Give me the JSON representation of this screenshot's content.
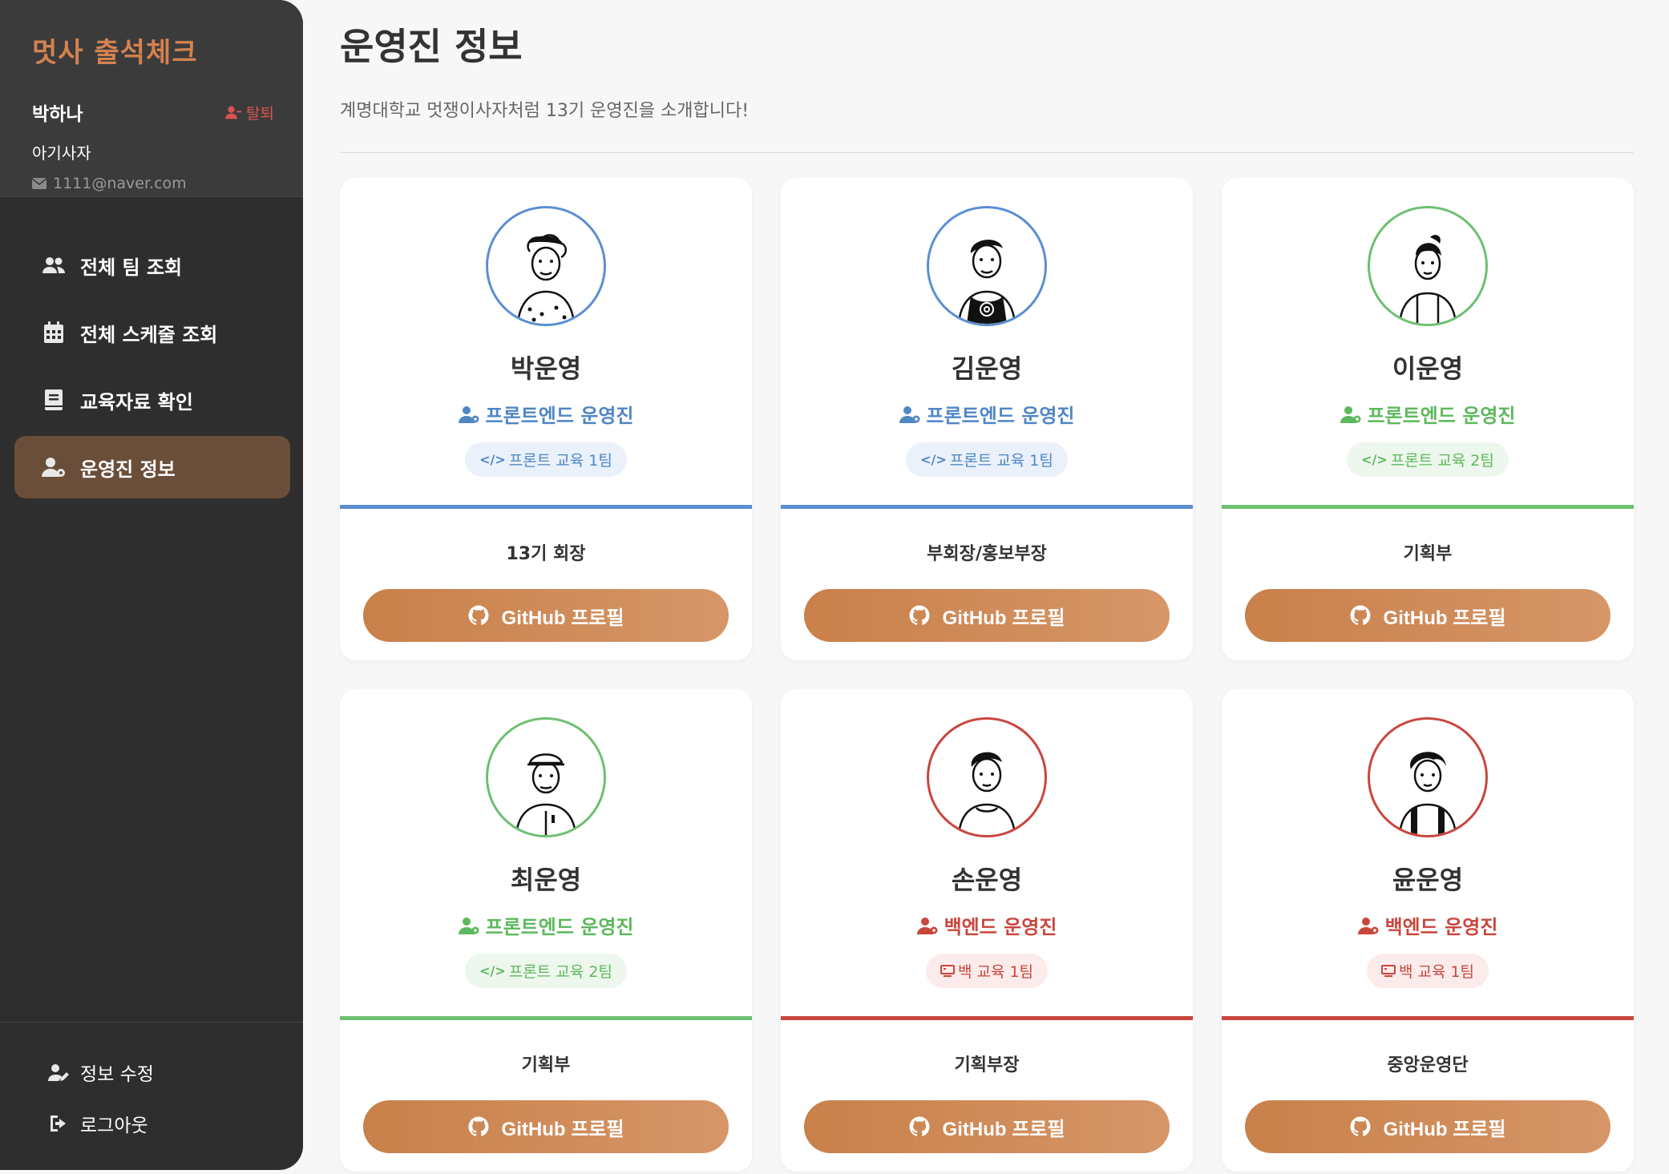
{
  "sidebar": {
    "app_title": "멋사 출석체크",
    "user": {
      "name": "박하나",
      "withdraw_label": "탈퇴",
      "role": "아기사자",
      "email": "1111@naver.com"
    },
    "nav": [
      {
        "label": "전체 팀 조회",
        "icon": "users-icon"
      },
      {
        "label": "전체 스케줄 조회",
        "icon": "calendar-icon"
      },
      {
        "label": "교육자료 확인",
        "icon": "book-icon"
      },
      {
        "label": "운영진 정보",
        "icon": "user-gear-icon",
        "active": true
      }
    ],
    "bottom": [
      {
        "label": "정보 수정",
        "icon": "user-edit-icon"
      },
      {
        "label": "로그아웃",
        "icon": "logout-icon"
      }
    ]
  },
  "main": {
    "title": "운영진 정보",
    "subtitle": "계명대학교 멋쟁이사자처럼 13기 운영진을 소개합니다!"
  },
  "colors": {
    "accent": "#d48250",
    "frontend_blue": "#5b8fd1",
    "frontend_green": "#6cc070",
    "backend_red": "#c9463d",
    "active_nav": "#6b4e3a"
  },
  "cards": [
    {
      "name": "박운영",
      "role": "프론트엔드 운영진",
      "team": "프론트 교육 1팀",
      "team_icon": "code-icon",
      "position": "13기 회장",
      "button": "GitHub 프로필",
      "theme": "blue"
    },
    {
      "name": "김운영",
      "role": "프론트엔드 운영진",
      "team": "프론트 교육 1팀",
      "team_icon": "code-icon",
      "position": "부회장/홍보부장",
      "button": "GitHub 프로필",
      "theme": "blue"
    },
    {
      "name": "이운영",
      "role": "프론트엔드 운영진",
      "team": "프론트 교육 2팀",
      "team_icon": "code-icon",
      "position": "기획부",
      "button": "GitHub 프로필",
      "theme": "green"
    },
    {
      "name": "최운영",
      "role": "프론트엔드 운영진",
      "team": "프론트 교육 2팀",
      "team_icon": "code-icon",
      "position": "기획부",
      "button": "GitHub 프로필",
      "theme": "green"
    },
    {
      "name": "손운영",
      "role": "백엔드 운영진",
      "team": "백 교육 1팀",
      "team_icon": "server-icon",
      "position": "기획부장",
      "button": "GitHub 프로필",
      "theme": "red"
    },
    {
      "name": "윤운영",
      "role": "백엔드 운영진",
      "team": "백 교육 1팀",
      "team_icon": "server-icon",
      "position": "중앙운영단",
      "button": "GitHub 프로필",
      "theme": "red"
    }
  ]
}
